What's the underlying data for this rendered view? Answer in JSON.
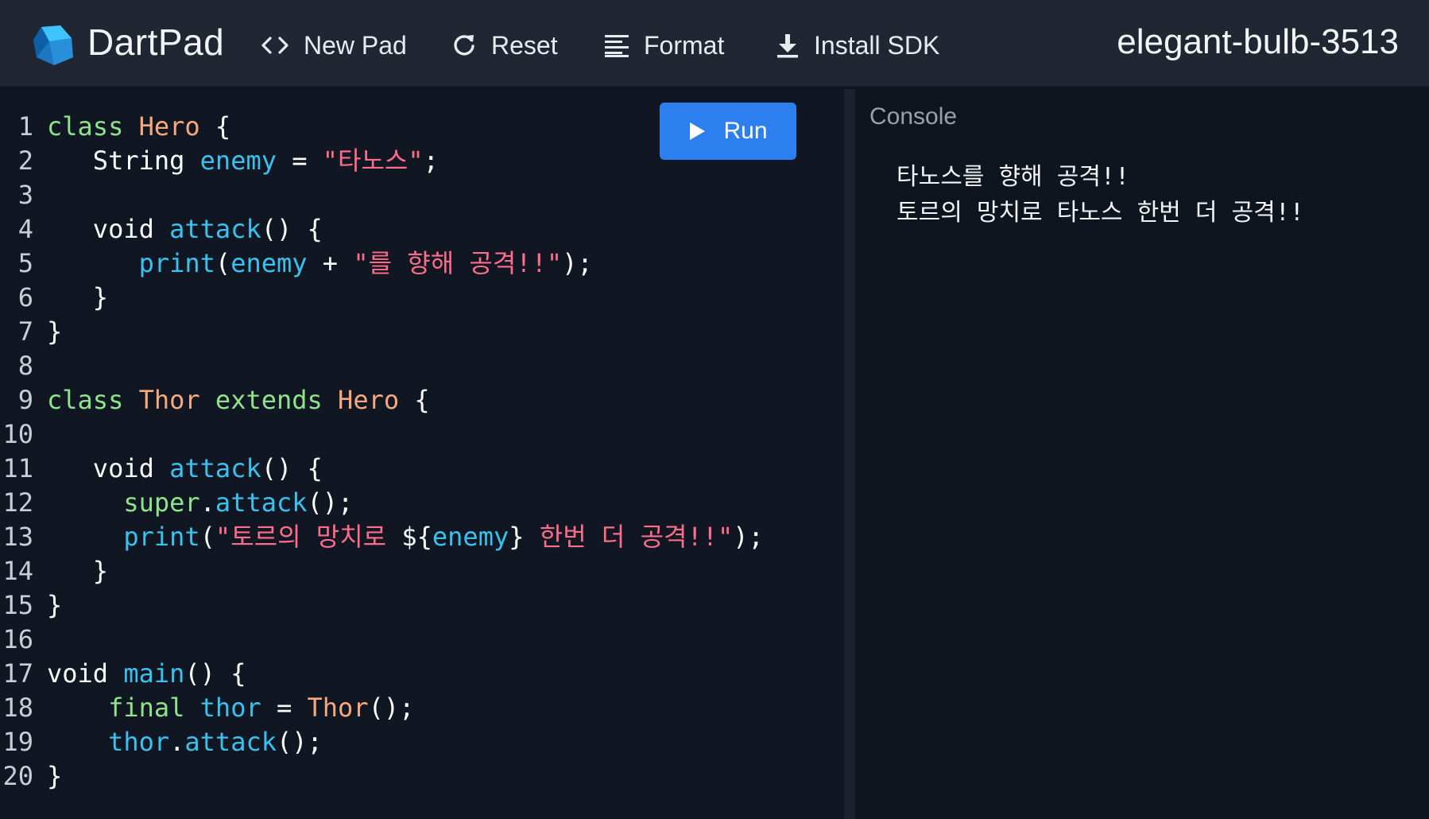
{
  "header": {
    "app_name": "DartPad",
    "buttons": {
      "new_pad": "New Pad",
      "reset": "Reset",
      "format": "Format",
      "install_sdk": "Install SDK"
    },
    "pad_name": "elegant-bulb-3513"
  },
  "editor": {
    "run_label": "Run",
    "lines": [
      {
        "n": "1",
        "tokens": [
          [
            "kw",
            "class"
          ],
          [
            "p",
            " "
          ],
          [
            "type",
            "Hero"
          ],
          [
            "p",
            " {"
          ]
        ]
      },
      {
        "n": "2",
        "tokens": [
          [
            "p",
            "   String "
          ],
          [
            "id",
            "enemy"
          ],
          [
            "p",
            " = "
          ],
          [
            "str",
            "\"타노스\""
          ],
          [
            "p",
            ";"
          ]
        ]
      },
      {
        "n": "3",
        "tokens": []
      },
      {
        "n": "4",
        "tokens": [
          [
            "p",
            "   void "
          ],
          [
            "id",
            "attack"
          ],
          [
            "p",
            "() {"
          ]
        ]
      },
      {
        "n": "5",
        "tokens": [
          [
            "p",
            "      "
          ],
          [
            "id",
            "print"
          ],
          [
            "p",
            "("
          ],
          [
            "id",
            "enemy"
          ],
          [
            "p",
            " + "
          ],
          [
            "str",
            "\"를 향해 공격!!\""
          ],
          [
            "p",
            ");"
          ]
        ]
      },
      {
        "n": "6",
        "tokens": [
          [
            "p",
            "   }"
          ]
        ]
      },
      {
        "n": "7",
        "tokens": [
          [
            "p",
            "}"
          ]
        ]
      },
      {
        "n": "8",
        "tokens": []
      },
      {
        "n": "9",
        "tokens": [
          [
            "kw",
            "class"
          ],
          [
            "p",
            " "
          ],
          [
            "type",
            "Thor"
          ],
          [
            "p",
            " "
          ],
          [
            "kw",
            "extends"
          ],
          [
            "p",
            " "
          ],
          [
            "type",
            "Hero"
          ],
          [
            "p",
            " {"
          ]
        ]
      },
      {
        "n": "10",
        "tokens": []
      },
      {
        "n": "11",
        "tokens": [
          [
            "p",
            "   void "
          ],
          [
            "id",
            "attack"
          ],
          [
            "p",
            "() {"
          ]
        ]
      },
      {
        "n": "12",
        "tokens": [
          [
            "p",
            "     "
          ],
          [
            "kw",
            "super"
          ],
          [
            "p",
            "."
          ],
          [
            "id",
            "attack"
          ],
          [
            "p",
            "();"
          ]
        ]
      },
      {
        "n": "13",
        "tokens": [
          [
            "p",
            "     "
          ],
          [
            "id",
            "print"
          ],
          [
            "p",
            "("
          ],
          [
            "str",
            "\"토르의 망치로 "
          ],
          [
            "p",
            "${"
          ],
          [
            "id",
            "enemy"
          ],
          [
            "p",
            "}"
          ],
          [
            "str",
            " 한번 더 공격!!\""
          ],
          [
            "p",
            ");"
          ]
        ]
      },
      {
        "n": "14",
        "tokens": [
          [
            "p",
            "   }"
          ]
        ]
      },
      {
        "n": "15",
        "tokens": [
          [
            "p",
            "}"
          ]
        ]
      },
      {
        "n": "16",
        "tokens": []
      },
      {
        "n": "17",
        "tokens": [
          [
            "p",
            "void "
          ],
          [
            "id",
            "main"
          ],
          [
            "p",
            "() {"
          ]
        ]
      },
      {
        "n": "18",
        "tokens": [
          [
            "p",
            "    "
          ],
          [
            "kw",
            "final"
          ],
          [
            "p",
            " "
          ],
          [
            "id",
            "thor"
          ],
          [
            "p",
            " = "
          ],
          [
            "type",
            "Thor"
          ],
          [
            "p",
            "();"
          ]
        ]
      },
      {
        "n": "19",
        "tokens": [
          [
            "p",
            "    "
          ],
          [
            "id",
            "thor"
          ],
          [
            "p",
            "."
          ],
          [
            "id",
            "attack"
          ],
          [
            "p",
            "();"
          ]
        ]
      },
      {
        "n": "20",
        "tokens": [
          [
            "p",
            "}"
          ]
        ]
      }
    ]
  },
  "console": {
    "title": "Console",
    "output": [
      "타노스를 향해 공격!!",
      "토르의 망치로 타노스 한번 더 공격!!"
    ]
  },
  "colors": {
    "keyword": "#8fe38a",
    "type": "#f6a97e",
    "identifier": "#39c2f0",
    "string": "#ff6d8a",
    "run_button": "#2d7ff0"
  },
  "icons": [
    "dart-logo-icon",
    "code-brackets-icon",
    "refresh-icon",
    "format-lines-icon",
    "download-icon",
    "play-icon"
  ]
}
